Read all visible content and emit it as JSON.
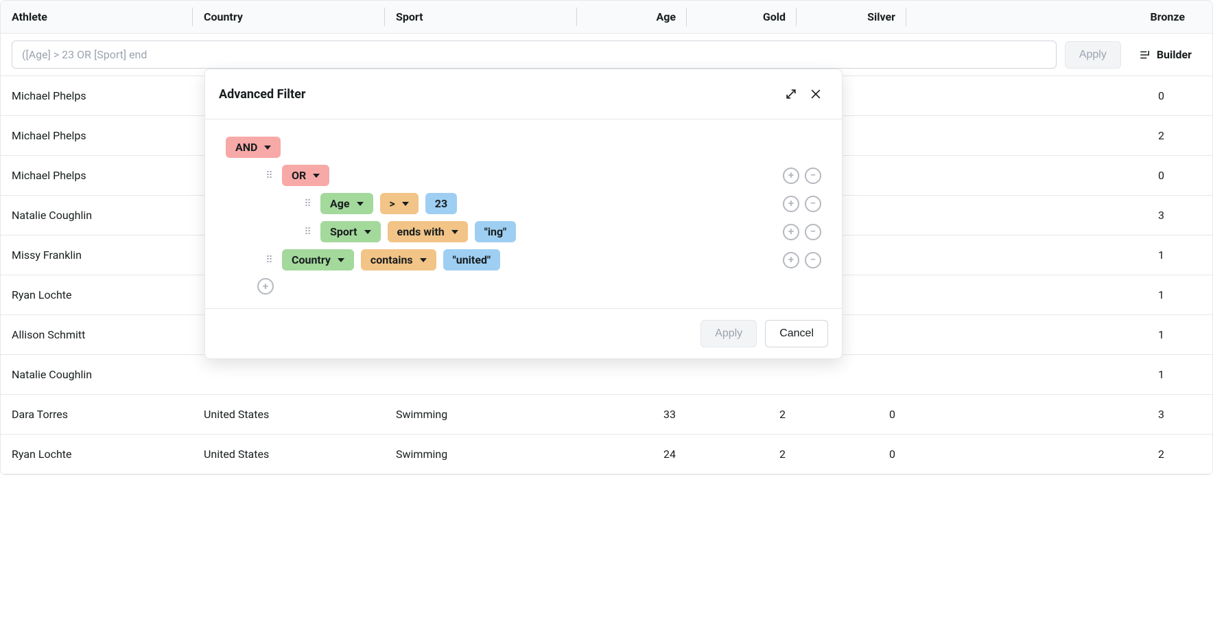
{
  "grid": {
    "columns": [
      "Athlete",
      "Country",
      "Sport",
      "Age",
      "Gold",
      "Silver",
      "Bronze"
    ],
    "filter_expression": "([Age] > 23 OR [Sport] end",
    "apply_label": "Apply",
    "builder_label": "Builder",
    "rows": [
      {
        "athlete": "Michael Phelps",
        "country": "",
        "sport": "",
        "age": "",
        "gold": "",
        "silver": "",
        "bronze": "0"
      },
      {
        "athlete": "Michael Phelps",
        "country": "",
        "sport": "",
        "age": "",
        "gold": "",
        "silver": "",
        "bronze": "2"
      },
      {
        "athlete": "Michael Phelps",
        "country": "",
        "sport": "",
        "age": "",
        "gold": "",
        "silver": "",
        "bronze": "0"
      },
      {
        "athlete": "Natalie Coughlin",
        "country": "",
        "sport": "",
        "age": "",
        "gold": "",
        "silver": "",
        "bronze": "3"
      },
      {
        "athlete": "Missy Franklin",
        "country": "",
        "sport": "",
        "age": "",
        "gold": "",
        "silver": "",
        "bronze": "1"
      },
      {
        "athlete": "Ryan Lochte",
        "country": "",
        "sport": "",
        "age": "",
        "gold": "",
        "silver": "",
        "bronze": "1"
      },
      {
        "athlete": "Allison Schmitt",
        "country": "",
        "sport": "",
        "age": "",
        "gold": "",
        "silver": "",
        "bronze": "1"
      },
      {
        "athlete": "Natalie Coughlin",
        "country": "",
        "sport": "",
        "age": "",
        "gold": "",
        "silver": "",
        "bronze": "1"
      },
      {
        "athlete": "Dara Torres",
        "country": "United States",
        "sport": "Swimming",
        "age": "33",
        "gold": "2",
        "silver": "0",
        "bronze": "3"
      },
      {
        "athlete": "Ryan Lochte",
        "country": "United States",
        "sport": "Swimming",
        "age": "24",
        "gold": "2",
        "silver": "0",
        "bronze": "2"
      }
    ]
  },
  "popup": {
    "title": "Advanced Filter",
    "apply_label": "Apply",
    "cancel_label": "Cancel",
    "root_join": "AND",
    "group1_join": "OR",
    "cond1": {
      "field": "Age",
      "op": ">",
      "value": "23"
    },
    "cond2": {
      "field": "Sport",
      "op": "ends with",
      "value": "\"ing\""
    },
    "cond3": {
      "field": "Country",
      "op": "contains",
      "value": "\"united\""
    }
  }
}
